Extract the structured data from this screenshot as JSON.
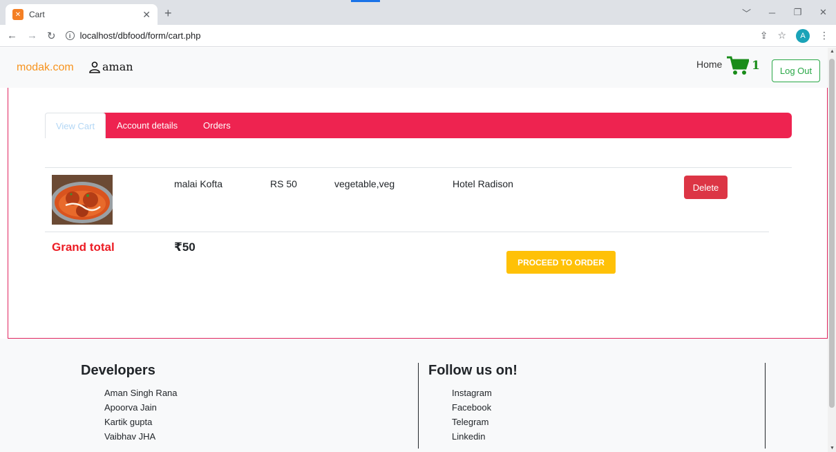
{
  "browser": {
    "tab_title": "Cart",
    "url": "localhost/dbfood/form/cart.php",
    "profile_initial": "A"
  },
  "navbar": {
    "brand": "modak.com",
    "username": "aman",
    "home": "Home",
    "cart_count": "1",
    "logout": "Log Out"
  },
  "tabs": {
    "view_cart": "View Cart",
    "account_details": "Account details",
    "orders": "Orders"
  },
  "cart_item": {
    "name": "malai Kofta",
    "price": "RS 50",
    "category": "vegetable,veg",
    "hotel": "Hotel Radison",
    "delete": "Delete"
  },
  "summary": {
    "grand_total_label": "Grand total",
    "grand_total_value": "₹50",
    "proceed": "PROCEED TO ORDER"
  },
  "footer": {
    "developers_heading": "Developers",
    "developers": [
      "Aman Singh Rana",
      "Apoorva Jain",
      "Kartik gupta",
      "Vaibhav JHA"
    ],
    "follow_heading": "Follow us on!",
    "social": [
      "Instagram",
      "Facebook",
      "Telegram",
      "Linkedin"
    ]
  },
  "colors": {
    "brand": "#f7931e",
    "accent": "#ee2350",
    "success": "#28a745",
    "danger": "#dc3545",
    "warning": "#ffc107"
  }
}
